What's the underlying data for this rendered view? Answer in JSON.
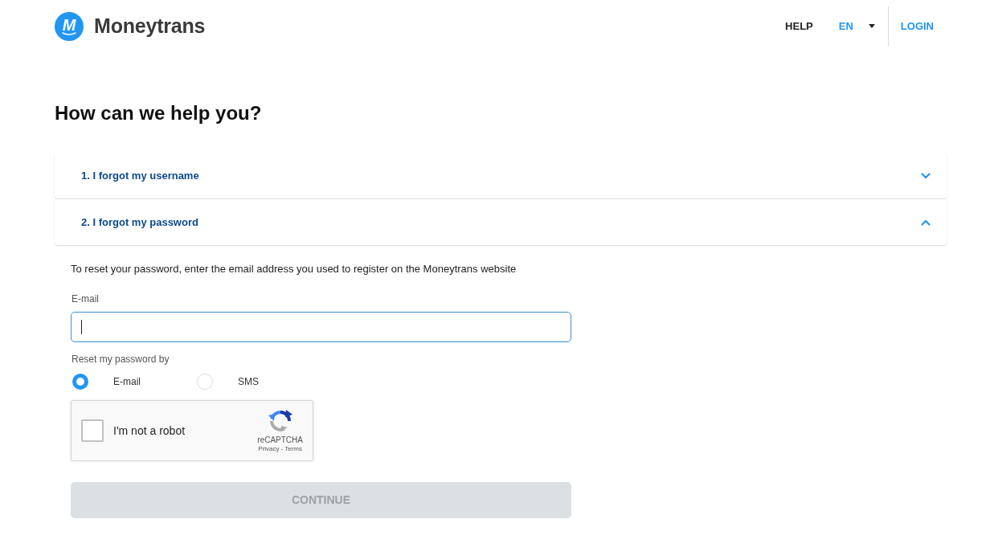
{
  "header": {
    "logo_letter": "M",
    "brand": "Moneytrans",
    "help": "HELP",
    "language": "EN",
    "login": "LOGIN"
  },
  "heading": "How can we help you?",
  "faq": [
    {
      "title": "1. I forgot my username",
      "expanded": false
    },
    {
      "title": "2. I forgot my password",
      "expanded": true,
      "body": {
        "intro": "To reset your password, enter the email address you used to register on the Moneytrans website",
        "email_field": {
          "label": "E-mail",
          "focused": true
        },
        "reset_method": {
          "label": "Reset my password by",
          "options": [
            {
              "label": "E-mail",
              "selected": true
            },
            {
              "label": "SMS",
              "selected": false
            }
          ]
        },
        "captcha": {
          "label": "I'm not a robot",
          "checked": false,
          "brand": "reCAPTCHA",
          "links": [
            "Privacy",
            "Terms"
          ],
          "separator": "-"
        },
        "button": {
          "label": "CONTINUE",
          "disabled": true
        }
      }
    }
  ]
}
